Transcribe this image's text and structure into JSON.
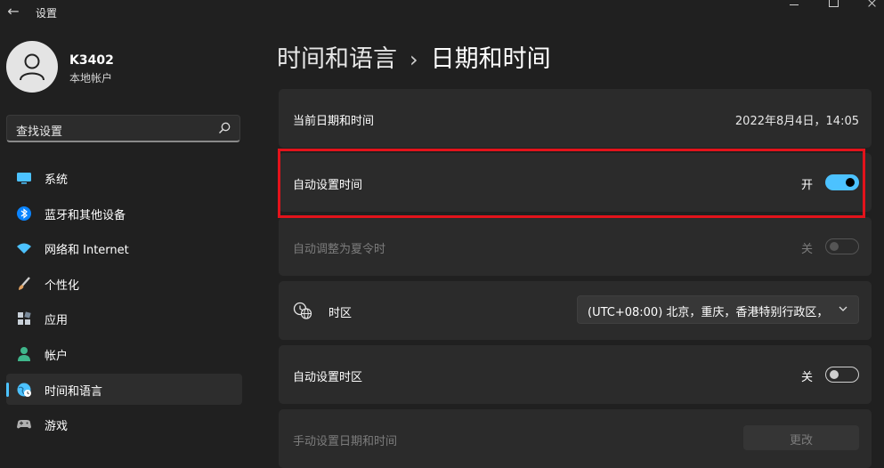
{
  "window": {
    "title": "设置",
    "back_glyph": "←"
  },
  "user": {
    "name": "K3402",
    "account_type": "本地帐户"
  },
  "search": {
    "placeholder": "查找设置"
  },
  "nav": {
    "items": [
      {
        "label": "系统",
        "icon": "monitor-icon",
        "color": "#4cc2ff"
      },
      {
        "label": "蓝牙和其他设备",
        "icon": "bluetooth-icon",
        "color": "#0a84ff"
      },
      {
        "label": "网络和 Internet",
        "icon": "wifi-icon",
        "color": "#4cc2ff"
      },
      {
        "label": "个性化",
        "icon": "brush-icon",
        "color": "#e0a060"
      },
      {
        "label": "应用",
        "icon": "apps-icon",
        "color": "#9ab"
      },
      {
        "label": "帐户",
        "icon": "person-icon",
        "color": "#3fb68b"
      },
      {
        "label": "时间和语言",
        "icon": "globe-clock-icon",
        "color": "#4cc2ff",
        "active": true
      },
      {
        "label": "游戏",
        "icon": "gamepad-icon",
        "color": "#aaa"
      }
    ]
  },
  "header": {
    "parent": "时间和语言",
    "separator": "›",
    "current": "日期和时间"
  },
  "settings": {
    "current_datetime": {
      "label": "当前日期和时间",
      "value": "2022年8月4日，14:05"
    },
    "auto_time": {
      "label": "自动设置时间",
      "state": "开",
      "on": true
    },
    "dst": {
      "label": "自动调整为夏令时",
      "state": "关",
      "on": false,
      "enabled": false
    },
    "timezone": {
      "label": "时区",
      "value": "(UTC+08:00) 北京，重庆，香港特别行政区，"
    },
    "auto_timezone": {
      "label": "自动设置时区",
      "state": "关",
      "on": false
    },
    "manual": {
      "label": "手动设置日期和时间",
      "button": "更改"
    }
  },
  "colors": {
    "accent": "#4cc2ff",
    "highlight": "#e3131b",
    "background": "#202020",
    "card": "#2b2b2b"
  }
}
